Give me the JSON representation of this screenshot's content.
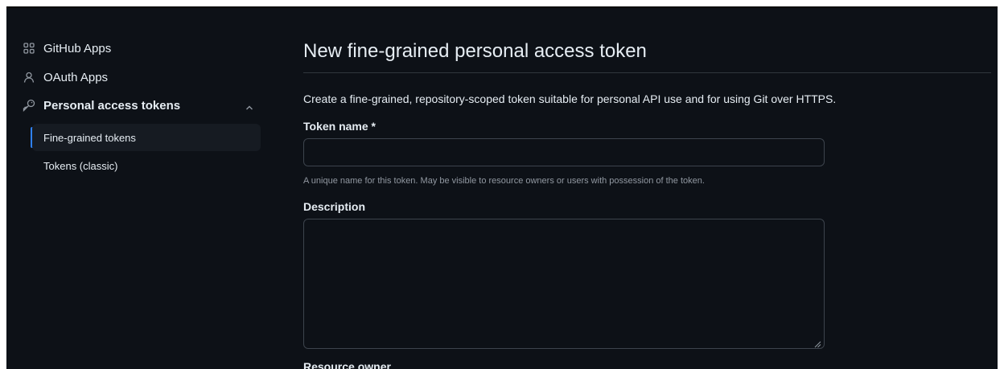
{
  "sidebar": {
    "items": [
      {
        "label": "GitHub Apps",
        "icon": "apps-icon"
      },
      {
        "label": "OAuth Apps",
        "icon": "person-icon"
      },
      {
        "label": "Personal access tokens",
        "icon": "key-icon",
        "expanded": true
      }
    ],
    "sub_items": [
      {
        "label": "Fine-grained tokens",
        "active": true
      },
      {
        "label": "Tokens (classic)",
        "active": false
      }
    ]
  },
  "main": {
    "title": "New fine-grained personal access token",
    "intro": "Create a fine-grained, repository-scoped token suitable for personal API use and for using Git over HTTPS.",
    "token_name": {
      "label": "Token name *",
      "value": "",
      "hint": "A unique name for this token. May be visible to resource owners or users with possession of the token."
    },
    "description": {
      "label": "Description",
      "value": ""
    },
    "resource_owner": {
      "label": "Resource owner"
    }
  },
  "colors": {
    "background": "#0d1117",
    "text": "#e6edf3",
    "muted": "#9198a1",
    "accent": "#2f81f7",
    "border": "#3d444d"
  }
}
